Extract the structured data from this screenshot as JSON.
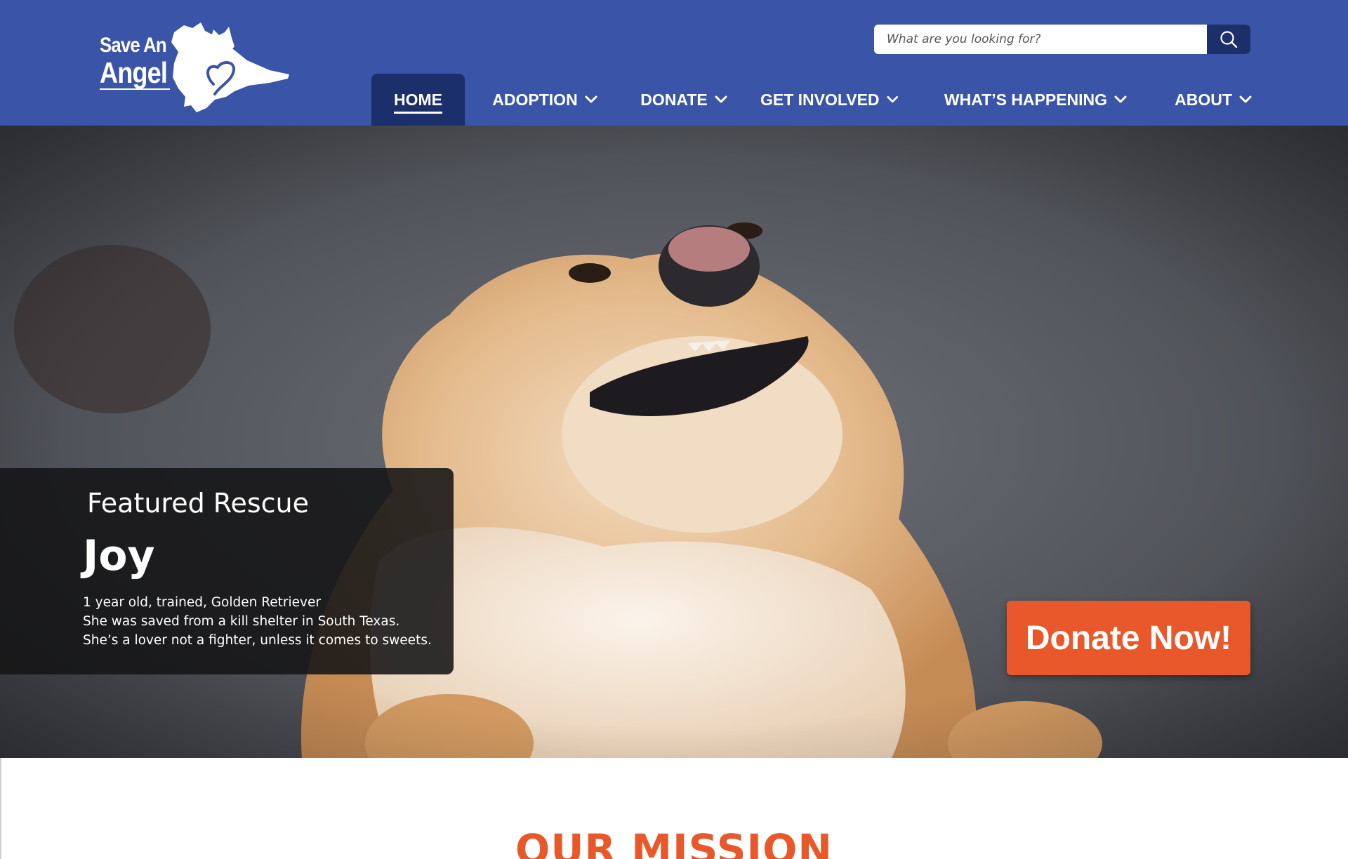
{
  "brand": {
    "line1": "Save An",
    "line2": "Angel"
  },
  "search": {
    "placeholder": "What are you looking for?"
  },
  "nav": {
    "items": [
      {
        "label": "HOME"
      },
      {
        "label": "ADOPTION"
      },
      {
        "label": "DONATE"
      },
      {
        "label": "GET INVOLVED"
      },
      {
        "label": "WHAT’S HAPPENING"
      },
      {
        "label": "ABOUT"
      }
    ]
  },
  "featured": {
    "kicker": "Featured Rescue",
    "name": "Joy",
    "lines": [
      "1 year old, trained, Golden Retriever",
      "She was saved from a kill shelter in South Texas.",
      "She’s a lover not a fighter, unless it comes to sweets."
    ]
  },
  "hero": {
    "cta_label": "Donate Now!"
  },
  "mission": {
    "heading": "OUR MISSION"
  },
  "colors": {
    "header_blue": "#3a54a8",
    "nav_active": "#1b2f6b",
    "accent_orange": "#e8582a"
  },
  "icons": {
    "search": "search-icon",
    "chevron": "chevron-down-icon",
    "logo_art": "dog-cat-heart-silhouette"
  }
}
